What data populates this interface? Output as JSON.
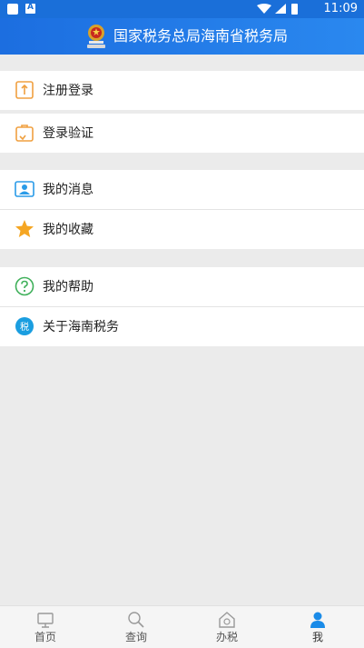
{
  "status_bar": {
    "time": "11:09"
  },
  "header": {
    "title": "国家税务总局海南省税务局",
    "accent": "#1c6ee0"
  },
  "menu": {
    "group1": [
      {
        "label": "注册登录",
        "icon": "register-login-icon"
      }
    ],
    "group2": [
      {
        "label": "登录验证",
        "icon": "login-verify-icon"
      }
    ],
    "group3": [
      {
        "label": "我的消息",
        "icon": "message-icon"
      },
      {
        "label": "我的收藏",
        "icon": "star-icon"
      }
    ],
    "group4": [
      {
        "label": "我的帮助",
        "icon": "help-icon"
      },
      {
        "label": "关于海南税务",
        "icon": "tax-badge-icon",
        "badge": "税"
      }
    ]
  },
  "tabbar": {
    "tabs": [
      {
        "label": "首页",
        "icon": "computer-icon"
      },
      {
        "label": "查询",
        "icon": "search-icon"
      },
      {
        "label": "办税",
        "icon": "tax-building-icon"
      },
      {
        "label": "我",
        "icon": "person-icon",
        "active": true
      }
    ]
  }
}
